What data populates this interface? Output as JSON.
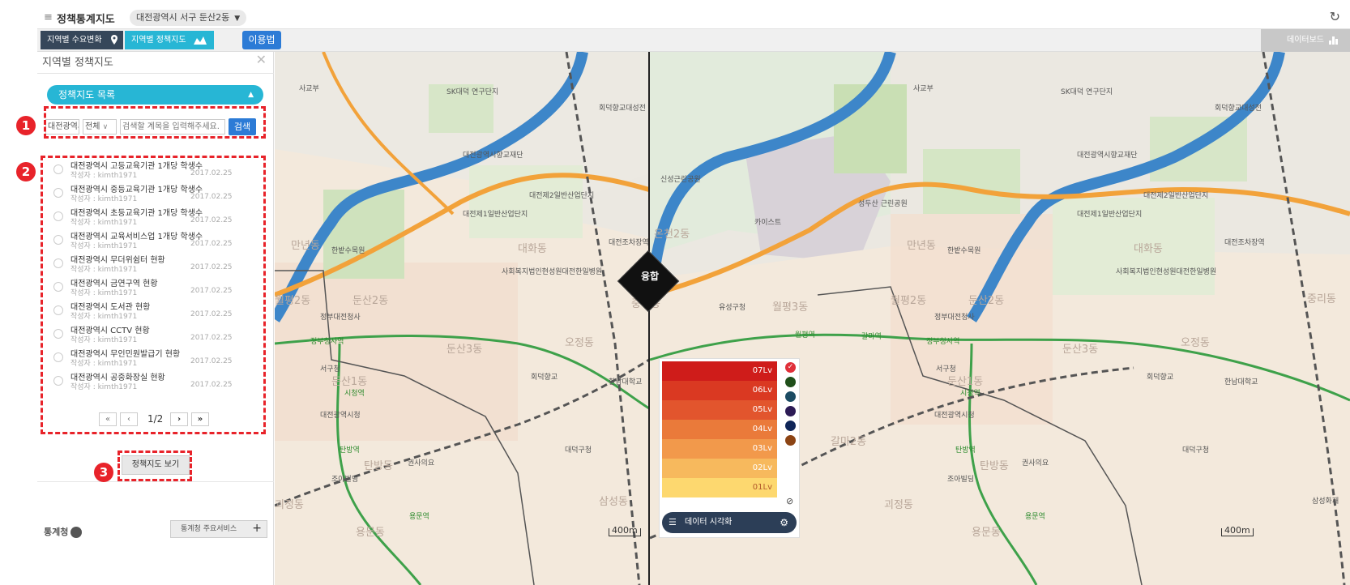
{
  "topbar": {
    "title": "정책통계지도",
    "region": "대전광역시 서구 둔산2동",
    "region_arrow": "▼",
    "refresh": "↻",
    "menu": "≡"
  },
  "toolbar": {
    "tab1": "지역별 수요변화",
    "tab2": "지역별 정책지도",
    "help": "이용법",
    "dashboard": "데이터보드"
  },
  "panel": {
    "title": "지역별 정책지도",
    "close": "✕",
    "list_header": "정책지도 목록",
    "filter1": "대전광역시",
    "filter2": "전체",
    "search_placeholder": "검색할 계목을 입력해주세요.",
    "search_button": "검색",
    "items": [
      {
        "name": "대전광역시 고등교육기관 1개당 학생수",
        "author": "작성자 : kimth1971",
        "date": "2017.02.25"
      },
      {
        "name": "대전광역시 중등교육기관 1개당 학생수",
        "author": "작성자 : kimth1971",
        "date": "2017.02.25"
      },
      {
        "name": "대전광역시 초등교육기관 1개당 학생수",
        "author": "작성자 : kimth1971",
        "date": "2017.02.25"
      },
      {
        "name": "대전광역시 교육서비스업 1개당 학생수",
        "author": "작성자 : kimth1971",
        "date": "2017.02.25"
      },
      {
        "name": "대전광역시 무더위쉼터 현황",
        "author": "작성자 : kimth1971",
        "date": "2017.02.25"
      },
      {
        "name": "대전광역시 금연구역 현황",
        "author": "작성자 : kimth1971",
        "date": "2017.02.25"
      },
      {
        "name": "대전광역시 도서관 현황",
        "author": "작성자 : kimth1971",
        "date": "2017.02.25"
      },
      {
        "name": "대전광역시 CCTV 현황",
        "author": "작성자 : kimth1971",
        "date": "2017.02.25"
      },
      {
        "name": "대전광역시 무인민원발급기 현황",
        "author": "작성자 : kimth1971",
        "date": "2017.02.25"
      },
      {
        "name": "대전광역시 공중화장실 현황",
        "author": "작성자 : kimth1971",
        "date": "2017.02.25"
      }
    ],
    "pager": {
      "first": "«",
      "prev": "‹",
      "text": "1/2",
      "next": "›",
      "last": "»"
    },
    "view_button": "정책지도 보기",
    "logo": "통계청",
    "services_button": "통계청 주요서비스",
    "services_plus": "+"
  },
  "annotations": [
    "1",
    "2",
    "3"
  ],
  "map": {
    "overlay_button": "융합",
    "labels": [
      "사교부",
      "SK대덕 연구단지",
      "회덕향교대성전",
      "대전광역시향교재단",
      "대전제2일반산업단지",
      "대전제1일반산업단지",
      "한밭수목원",
      "사회복지법인현성원대전한일병원",
      "정부대전청사",
      "서구청",
      "대전광역시청",
      "회덕향교",
      "한남대학교",
      "대덕구청",
      "권사의요",
      "조아빌딩",
      "대전조차장역",
      "신성근린공원",
      "카이스트",
      "성두산 근린공원",
      "유성구청",
      "삼성화재"
    ],
    "dong_labels": [
      "만년동",
      "대화동",
      "둔산2동",
      "월평2동",
      "둔산1동",
      "둔산3동",
      "탄방동",
      "용문동",
      "오정동",
      "중리동",
      "괴정동",
      "월평3동",
      "온천2동",
      "갈마2동",
      "삼성동"
    ],
    "stations": [
      "정부청사역",
      "시청역",
      "탄방역",
      "용문역",
      "갈마역",
      "월평역"
    ],
    "scale": "400m"
  },
  "legend": {
    "levels": [
      {
        "label": "07Lv",
        "color": "#cf1c1a"
      },
      {
        "label": "06Lv",
        "color": "#da3922"
      },
      {
        "label": "05Lv",
        "color": "#e2552d"
      },
      {
        "label": "04Lv",
        "color": "#ea7a3a"
      },
      {
        "label": "03Lv",
        "color": "#f2994b"
      },
      {
        "label": "02Lv",
        "color": "#f7b95d"
      },
      {
        "label": "01Lv",
        "color": "#fdd86f"
      }
    ],
    "palette": [
      "#1f4f1a",
      "#1b4b63",
      "#2c1b55",
      "#0f2558",
      "#8c4414"
    ],
    "check": "✓",
    "ban": "⊘",
    "viz_button": "데이터 시각화",
    "viz_list_icon": "☰",
    "viz_gear_icon": "⚙"
  }
}
